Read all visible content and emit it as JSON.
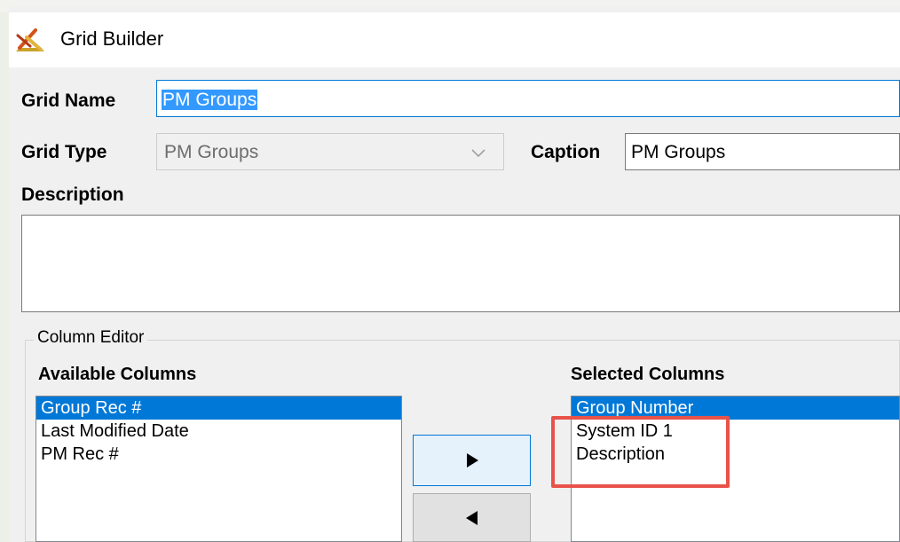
{
  "window": {
    "title": "Grid Builder",
    "icon": "grid-builder-app-icon"
  },
  "form": {
    "grid_name_label": "Grid Name",
    "grid_name_value": "PM Groups",
    "grid_type_label": "Grid Type",
    "grid_type_value": "PM Groups",
    "caption_label": "Caption",
    "caption_value": "PM Groups",
    "description_label": "Description",
    "description_value": ""
  },
  "column_editor": {
    "caption": "Column Editor",
    "available_label": "Available Columns",
    "selected_label": "Selected Columns",
    "available_items": [
      "Group Rec #",
      "Last Modified Date",
      "PM Rec #"
    ],
    "available_selected_index": 0,
    "selected_items": [
      "Group Number",
      "System ID 1",
      "Description"
    ],
    "selected_selected_index": 0,
    "add_button_icon": "right-arrow-icon",
    "remove_button_icon": "left-arrow-icon"
  },
  "colors": {
    "selection": "#0078d7",
    "text_selection": "#3399ff",
    "annotation": "#e8524a"
  }
}
